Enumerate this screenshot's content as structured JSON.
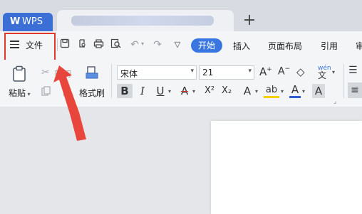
{
  "titlebar": {
    "app_tab": "WPS",
    "app_logo": "W",
    "new_tab_icon": "plus-icon"
  },
  "menu": {
    "file_label": "文件",
    "tabs": [
      "开始",
      "插入",
      "页面布局",
      "引用",
      "审"
    ],
    "active_tab": "开始",
    "quick_access_icons": [
      "save-icon",
      "export-icon",
      "print-icon",
      "preview-icon",
      "undo-icon",
      "redo-icon",
      "customize-icon"
    ]
  },
  "ribbon": {
    "paste_label": "粘贴",
    "cut_label": "剪切",
    "copy_label": "制",
    "format_painter_label": "格式刷",
    "font_name": "宋体",
    "font_size": "21",
    "format_buttons": [
      "B",
      "I",
      "U",
      "A",
      "X²",
      "X₂",
      "A",
      "ab",
      "A",
      "A"
    ]
  },
  "colors": {
    "accent": "#3a76e0",
    "highlight_box": "#e0382d",
    "arrow": "#e8453c",
    "wps_tab": "#3c6fd6"
  }
}
